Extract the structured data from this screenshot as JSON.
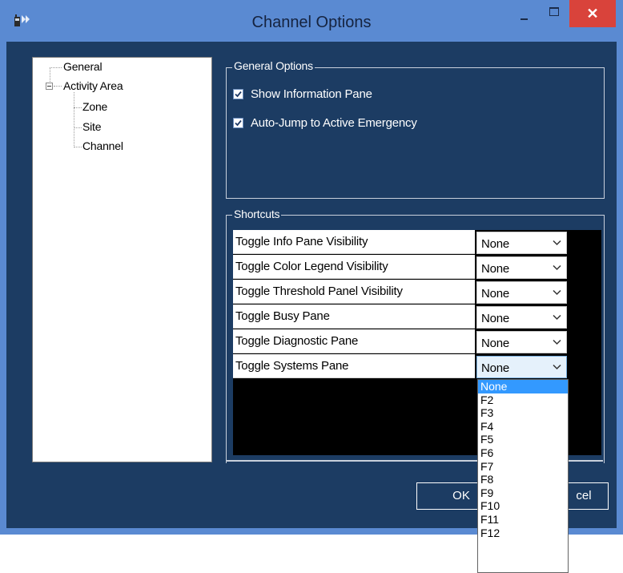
{
  "window": {
    "title": "Channel Options",
    "close_glyph": "✕"
  },
  "tree": {
    "items": [
      {
        "label": "General"
      },
      {
        "label": "Activity Area"
      },
      {
        "label": "Zone"
      },
      {
        "label": "Site"
      },
      {
        "label": "Channel"
      }
    ]
  },
  "general_options": {
    "label": "General Options",
    "checkboxes": [
      {
        "label": "Show Information Pane",
        "checked": true
      },
      {
        "label": "Auto-Jump to Active Emergency",
        "checked": true
      }
    ]
  },
  "shortcuts": {
    "label": "Shortcuts",
    "rows": [
      {
        "name": "Toggle Info Pane Visibility",
        "key": "None"
      },
      {
        "name": "Toggle Color Legend Visibility",
        "key": "None"
      },
      {
        "name": "Toggle Threshold Panel Visibility",
        "key": "None"
      },
      {
        "name": "Toggle Busy Pane",
        "key": "None"
      },
      {
        "name": "Toggle Diagnostic Pane",
        "key": "None"
      },
      {
        "name": "Toggle Systems Pane",
        "key": "None"
      }
    ]
  },
  "buttons": {
    "ok": "OK",
    "cancel_visible": "cel"
  },
  "dropdown": {
    "options": [
      "None",
      "F2",
      "F3",
      "F4",
      "F5",
      "F6",
      "F7",
      "F8",
      "F9",
      "F10",
      "F11",
      "F12"
    ],
    "selected": "None"
  },
  "colors": {
    "frame": "#5a8ad2",
    "client": "#1c3c63",
    "close": "#d9433b",
    "selection": "#3399ff"
  }
}
